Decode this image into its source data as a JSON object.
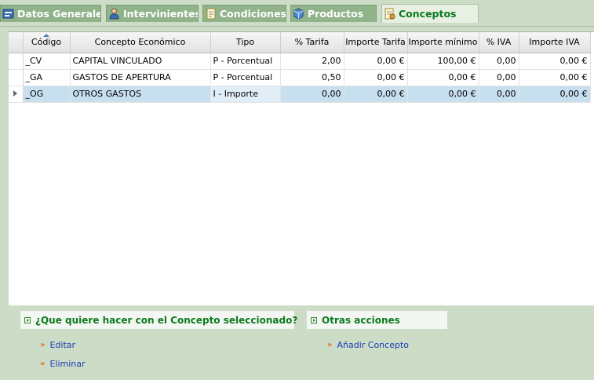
{
  "tabs": [
    {
      "label": "Datos Generales",
      "icon": "general-data-icon"
    },
    {
      "label": "Intervinientes",
      "icon": "person-icon"
    },
    {
      "label": "Condiciones",
      "icon": "document-icon"
    },
    {
      "label": "Productos",
      "icon": "cube-icon"
    },
    {
      "label": "Conceptos",
      "icon": "concepts-icon",
      "active": true
    }
  ],
  "grid": {
    "columns": [
      "Código",
      "Concepto Económico",
      "Tipo",
      "% Tarifa",
      "Importe Tarifa",
      "Importe mínimo",
      "% IVA",
      "Importe IVA"
    ],
    "rows": [
      [
        "_CV",
        "CAPITAL VINCULADO",
        "P - Porcentual",
        "2,00",
        "0,00 €",
        "100,00 €",
        "0,00",
        "0,00 €"
      ],
      [
        "_GA",
        "GASTOS DE APERTURA",
        "P - Porcentual",
        "0,50",
        "0,00 €",
        "0,00 €",
        "0,00",
        "0,00 €"
      ],
      [
        "_OG",
        "OTROS GASTOS",
        "I - Importe",
        "0,00",
        "0,00 €",
        "0,00 €",
        "0,00",
        "0,00 €"
      ]
    ],
    "selected_row": 2
  },
  "actions": {
    "selected_title": "¿Que quiere hacer con el Concepto seleccionado?",
    "edit": "Editar",
    "delete": "Eliminar",
    "other_title": "Otras acciones",
    "add": "Añadir Concepto"
  },
  "colors": {
    "background": "#cddcc6",
    "tab_inactive": "#91b38a",
    "tab_active_text": "#0b7a1c",
    "selected_row": "#c8dff0",
    "link": "#1b3db5"
  }
}
